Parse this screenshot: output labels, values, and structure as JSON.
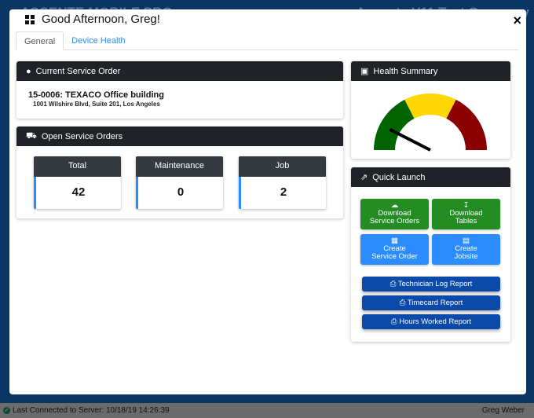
{
  "background_app": {
    "title_left": "ASCENTE MOBILE PRO",
    "title_right": "Ascente V11 Test Company"
  },
  "modal": {
    "title": "Good Afternoon, Greg!",
    "close_label": "×",
    "tabs": [
      {
        "label": "General",
        "active": true
      },
      {
        "label": "Device Health",
        "active": false
      }
    ]
  },
  "current_service_order": {
    "header": "Current Service Order",
    "title": "15-0006: TEXACO Office building",
    "address": "1001 Wilshire Blvd, Suite 201, Los Angeles"
  },
  "open_service_orders": {
    "header": "Open Service Orders",
    "stats": [
      {
        "label": "Total",
        "value": "42"
      },
      {
        "label": "Maintenance",
        "value": "0"
      },
      {
        "label": "Job",
        "value": "2"
      }
    ]
  },
  "health_summary": {
    "header": "Health Summary",
    "gauge_level": 0.15,
    "colors": {
      "good": "#006400",
      "warn": "#ffd700",
      "bad": "#8b0000"
    }
  },
  "quick_launch": {
    "header": "Quick Launch",
    "buttons": [
      {
        "line1": "Download",
        "line2": "Service Orders",
        "icon": "cloud-download-icon"
      },
      {
        "line1": "Download",
        "line2": "Tables",
        "icon": "download-icon"
      },
      {
        "line1": "Create",
        "line2": "Service Order",
        "icon": "calendar-plus-icon"
      },
      {
        "line1": "Create",
        "line2": "Jobsite",
        "icon": "id-card-icon"
      }
    ],
    "reports": [
      {
        "label": "Technician Log Report"
      },
      {
        "label": "Timecard Report"
      },
      {
        "label": "Hours Worked Report"
      }
    ]
  },
  "status_bar": {
    "connection": "Last Connected to Server: 10/18/19 14:26:39",
    "user": "Greg Weber"
  }
}
